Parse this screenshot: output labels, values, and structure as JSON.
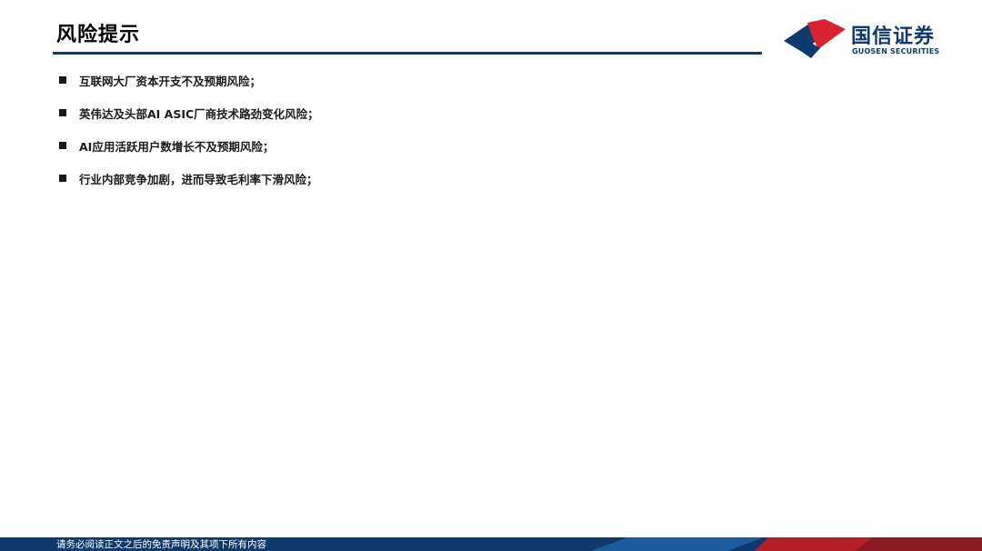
{
  "header": {
    "title": "风险提示"
  },
  "logo": {
    "name_cn": "国信证券",
    "name_en": "GUOSEN SECURITIES",
    "colors": {
      "blue": "#0e3a6e",
      "red": "#d9232e"
    }
  },
  "risks": [
    "互联网大厂资本开支不及预期风险；",
    "英伟达及头部AI ASIC厂商技术路劲变化风险；",
    "AI应用活跃用户数增长不及预期风险；",
    "行业内部竞争加剧，进而导致毛利率下滑风险；"
  ],
  "footer": {
    "disclaimer": "请务必阅读正文之后的免责声明及其项下所有内容",
    "colors": {
      "blue": "#0e3a6e",
      "red": "#b3202a"
    }
  }
}
